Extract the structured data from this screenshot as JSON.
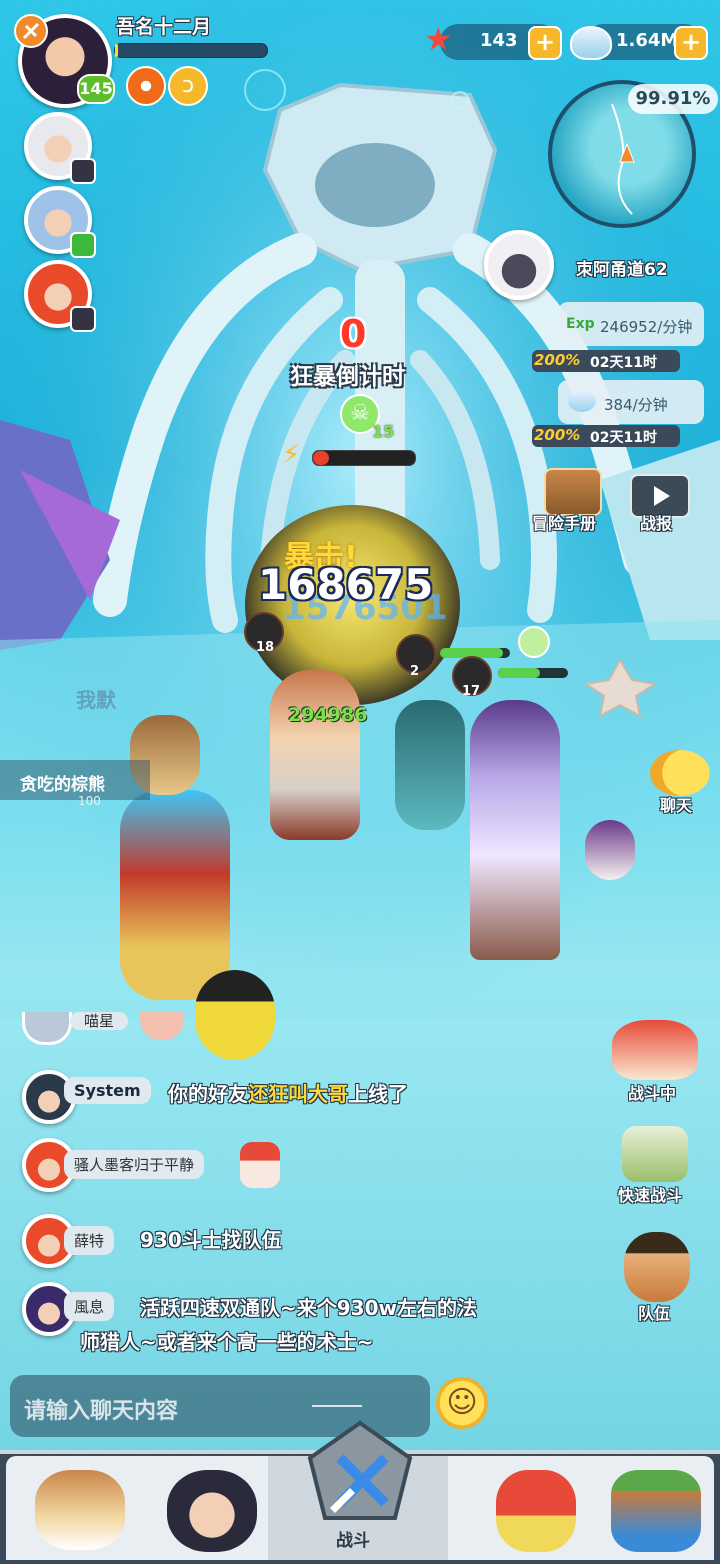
{
  "player": {
    "name": "吾名十二月",
    "level": "145",
    "exp_progress": 0.02
  },
  "party_avatars": [
    {
      "name": "party-avatar-1",
      "hair": "#e8e8ef"
    },
    {
      "name": "party-avatar-2",
      "hair": "#9fc3e8"
    },
    {
      "name": "party-avatar-3",
      "hair": "#e84a2a"
    }
  ],
  "currency": {
    "starfish_count": "143",
    "shell_count": "1.64M"
  },
  "minimap": {
    "percent": "99.91%",
    "location": "朿阿甬道62"
  },
  "rage": {
    "countdown": "0",
    "label": "狂暴倒计时",
    "skull_count": "15"
  },
  "rewards": {
    "exp_label": "Exp",
    "exp_rate": "246952/分钟",
    "exp_bonus": "200%",
    "exp_time": "02天11时",
    "shell_rate": "384/分钟",
    "shell_bonus": "200%",
    "shell_time": "02天11时"
  },
  "buttons": {
    "adventure_manual": "冒险手册",
    "battle_report": "战报",
    "chat": "聊天",
    "in_battle": "战斗中",
    "quick_battle": "快速战斗",
    "team": "队伍"
  },
  "battle": {
    "crit_text": "暴击!",
    "damage_main": "168675",
    "damage_back": "1576501",
    "damage_green": "294986",
    "enemy_levels": [
      "18",
      "2",
      "17"
    ],
    "npc_name": "贪吃的棕熊",
    "npc_level": "100",
    "faded_name": "我默"
  },
  "chat": {
    "partial_name": "喵星",
    "messages": [
      {
        "sender": "System",
        "prefix": "你的好友",
        "highlight": "还狂叫大哥",
        "suffix": "上线了"
      },
      {
        "sender": "骚人墨客归于平静",
        "text": ""
      },
      {
        "sender": "薛特",
        "text": "930斗士找队伍"
      },
      {
        "sender": "風息",
        "text": "活跃四速双通队~来个930w左右的法",
        "text2": "师猎人~或者来个高一些的术士~"
      }
    ],
    "input_placeholder": "请输入聊天内容"
  },
  "nav": {
    "battle_label": "战斗"
  },
  "colors": {
    "highlight": "#ffd83a",
    "bonus": "#ffcc33",
    "exp_green": "#7ee04a",
    "panel": "#2a5a7a"
  }
}
